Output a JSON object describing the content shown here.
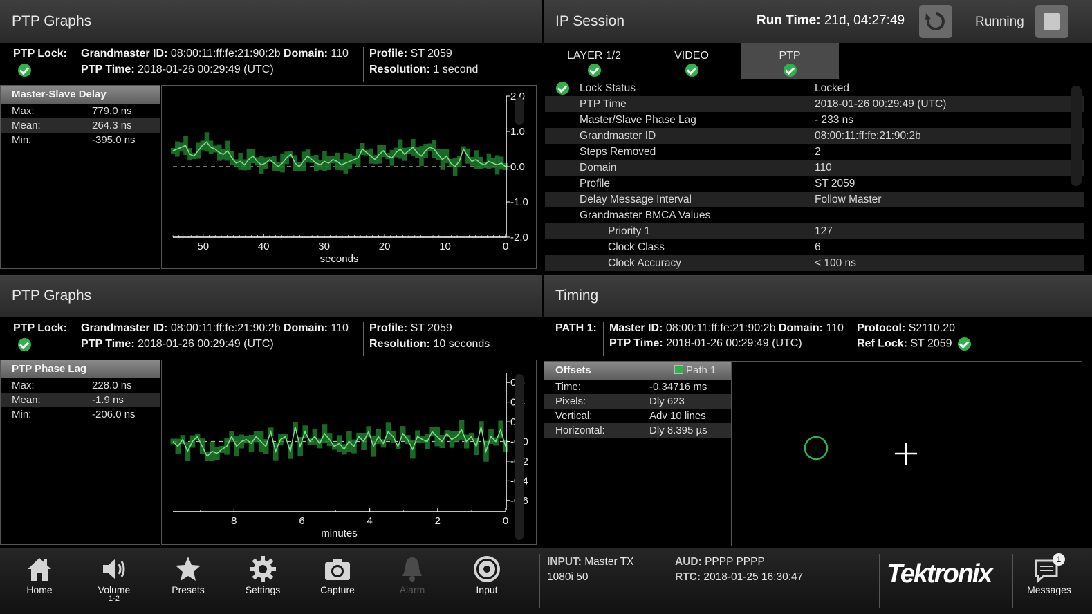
{
  "ptp_top": {
    "title": "PTP Graphs",
    "lock_label": "PTP Lock:",
    "gm_label": "Grandmaster ID:",
    "gm_value": "08:00:11:ff:fe:21:90:2b",
    "domain_label": "Domain:",
    "domain_value": "110",
    "time_label": "PTP Time:",
    "time_value": "2018-01-26 00:29:49 (UTC)",
    "profile_label": "Profile:",
    "profile_value": "ST 2059",
    "res_label": "Resolution:",
    "res_value": "1 second",
    "stats_title": "Master-Slave Delay",
    "stats": [
      {
        "label": "Max:",
        "value": "779.0 ns"
      },
      {
        "label": "Mean:",
        "value": "264.3 ns"
      },
      {
        "label": "Min:",
        "value": "-395.0 ns"
      }
    ]
  },
  "ptp_bottom": {
    "title": "PTP Graphs",
    "lock_label": "PTP Lock:",
    "gm_label": "Grandmaster ID:",
    "gm_value": "08:00:11:ff:fe:21:90:2b",
    "domain_label": "Domain:",
    "domain_value": "110",
    "time_label": "PTP Time:",
    "time_value": "2018-01-26 00:29:49 (UTC)",
    "profile_label": "Profile:",
    "profile_value": "ST 2059",
    "res_label": "Resolution:",
    "res_value": "10 seconds",
    "stats_title": "PTP Phase Lag",
    "stats": [
      {
        "label": "Max:",
        "value": "228.0 ns"
      },
      {
        "label": "Mean:",
        "value": "-1.9 ns"
      },
      {
        "label": "Min:",
        "value": "-206.0 ns"
      }
    ]
  },
  "ip_session": {
    "title": "IP Session",
    "runtime_label": "Run Time:",
    "runtime_value": "21d, 04:27:49",
    "status": "Running",
    "tabs": [
      {
        "label": "LAYER 1/2",
        "active": false
      },
      {
        "label": "VIDEO",
        "active": false
      },
      {
        "label": "PTP",
        "active": true
      }
    ],
    "rows": [
      {
        "label": "Lock Status",
        "value": "Locked",
        "indent": 0
      },
      {
        "label": "PTP Time",
        "value": "2018-01-26 00:29:49 (UTC)",
        "indent": 0
      },
      {
        "label": "Master/Slave Phase Lag",
        "value": "- 233 ns",
        "indent": 0
      },
      {
        "label": "Grandmaster ID",
        "value": "08:00:11:ff:fe:21:90:2b",
        "indent": 0
      },
      {
        "label": "Steps Removed",
        "value": "2",
        "indent": 0
      },
      {
        "label": "Domain",
        "value": "110",
        "indent": 0
      },
      {
        "label": "Profile",
        "value": "ST 2059",
        "indent": 0
      },
      {
        "label": "Delay Message Interval",
        "value": "Follow Master",
        "indent": 0
      },
      {
        "label": "Grandmaster BMCA Values",
        "value": "",
        "indent": 0
      },
      {
        "label": "Priority 1",
        "value": "127",
        "indent": 1
      },
      {
        "label": "Clock Class",
        "value": "6",
        "indent": 1
      },
      {
        "label": "Clock Accuracy",
        "value": "< 100 ns",
        "indent": 1
      }
    ]
  },
  "timing": {
    "title": "Timing",
    "path_label": "PATH 1:",
    "master_label": "Master ID:",
    "master_value": "08:00:11:ff:fe:21:90:2b",
    "domain_label": "Domain:",
    "domain_value": "110",
    "time_label": "PTP Time:",
    "time_value": "2018-01-26 00:29:49 (UTC)",
    "protocol_label": "Protocol:",
    "protocol_value": "S2110.20",
    "reflock_label": "Ref Lock:",
    "reflock_value": "ST 2059",
    "offsets_title": "Offsets",
    "legend": "Path 1",
    "offsets": [
      {
        "label": "Time:",
        "value": "-0.34716 ms"
      },
      {
        "label": "Pixels:",
        "value": "Dly 623"
      },
      {
        "label": "Vertical:",
        "value": "Adv 10 lines"
      },
      {
        "label": "Horizontal:",
        "value": "Dly 8.395 µs"
      }
    ]
  },
  "toolbar": {
    "buttons": [
      {
        "label": "Home",
        "sub": "",
        "icon": "home-icon"
      },
      {
        "label": "Volume",
        "sub": "1-2",
        "icon": "volume-icon"
      },
      {
        "label": "Presets",
        "sub": "",
        "icon": "star-icon"
      },
      {
        "label": "Settings",
        "sub": "",
        "icon": "gear-icon"
      },
      {
        "label": "Capture",
        "sub": "",
        "icon": "camera-icon"
      },
      {
        "label": "Alarm",
        "sub": "",
        "icon": "bell-icon"
      },
      {
        "label": "Input",
        "sub": "",
        "icon": "target-icon"
      }
    ],
    "input_label": "INPUT:",
    "input_value": "Master TX",
    "format": "1080i 50",
    "aud_label": "AUD:",
    "aud_value": "PPPP PPPP",
    "rtc_label": "RTC:",
    "rtc_value": "2018-01-25 16:30:47",
    "logo": "Tektronix",
    "messages_label": "Messages",
    "messages_count": "1"
  },
  "chart_data": [
    {
      "type": "line",
      "title": "Master-Slave Delay",
      "xlabel": "seconds",
      "ylabel": "",
      "xlim": [
        55,
        0
      ],
      "ylim": [
        -2.0,
        2.0
      ],
      "x_ticks": [
        50,
        40,
        30,
        20,
        10,
        0
      ],
      "y_ticks": [
        "2.0",
        "1.0",
        "0.0",
        "-1.0",
        "-2.0"
      ],
      "series": [
        {
          "y": [
            0.45,
            0.5,
            0.55,
            0.6,
            0.35,
            0.3,
            0.45,
            0.6,
            0.7,
            0.55,
            0.5,
            0.4,
            0.35,
            0.45,
            0.25,
            0.1,
            0.15,
            0.05,
            0.2,
            0.3,
            0.15,
            0.05,
            0.1,
            0.2,
            0.1,
            0.0,
            0.1,
            0.25,
            0.35,
            0.1,
            0.0,
            0.15,
            0.3,
            0.2,
            0.1,
            0.05,
            0.15,
            0.1,
            0.2,
            0.15,
            0.05,
            0.1,
            0.15,
            0.2,
            0.25,
            0.5,
            0.4,
            0.3,
            0.2,
            0.35,
            0.45,
            0.3,
            0.25,
            0.4,
            0.5,
            0.35,
            0.45,
            0.55,
            0.4,
            0.3,
            0.45,
            0.55,
            0.5,
            0.35,
            0.2,
            0.3,
            0.1,
            0.0,
            0.15,
            0.5,
            0.3,
            0.15,
            0.2,
            0.1,
            0.05,
            0.15,
            0.1,
            0.05,
            0.1,
            0.0
          ]
        }
      ]
    },
    {
      "type": "line",
      "title": "PTP Phase Lag",
      "xlabel": "minutes",
      "ylabel": "",
      "xlim": [
        9.8,
        0
      ],
      "ylim": [
        -0.7,
        0.7
      ],
      "x_ticks": [
        8,
        6,
        4,
        2,
        0
      ],
      "y_ticks": [
        "0.6",
        "0.4",
        "0.2",
        "-0.0",
        "-0.2",
        "-0.4",
        "-0.6"
      ],
      "series": [
        {
          "y": [
            0.0,
            -0.05,
            0.02,
            -0.1,
            0.0,
            0.05,
            -0.05,
            -0.15,
            -0.1,
            -0.12,
            -0.08,
            -0.05,
            0.05,
            -0.05,
            0.0,
            0.02,
            -0.02,
            0.05,
            0.0,
            -0.05,
            0.1,
            -0.1,
            0.02,
            0.05,
            -0.1,
            0.15,
            -0.05,
            0.1,
            0.0,
            0.05,
            -0.02,
            0.08,
            0.02,
            -0.05,
            -0.02,
            -0.08,
            0.0,
            -0.05,
            0.05,
            0.0,
            0.1,
            -0.05,
            0.05,
            -0.02,
            0.1,
            0.05,
            -0.05,
            0.08,
            0.02,
            -0.08,
            0.05,
            0.02,
            0.0,
            0.1,
            0.05,
            0.0,
            0.08,
            0.02,
            0.05,
            0.12,
            0.0,
            0.05,
            -0.05,
            0.15,
            -0.1,
            0.05,
            0.0,
            0.12,
            -0.05
          ]
        }
      ]
    }
  ]
}
